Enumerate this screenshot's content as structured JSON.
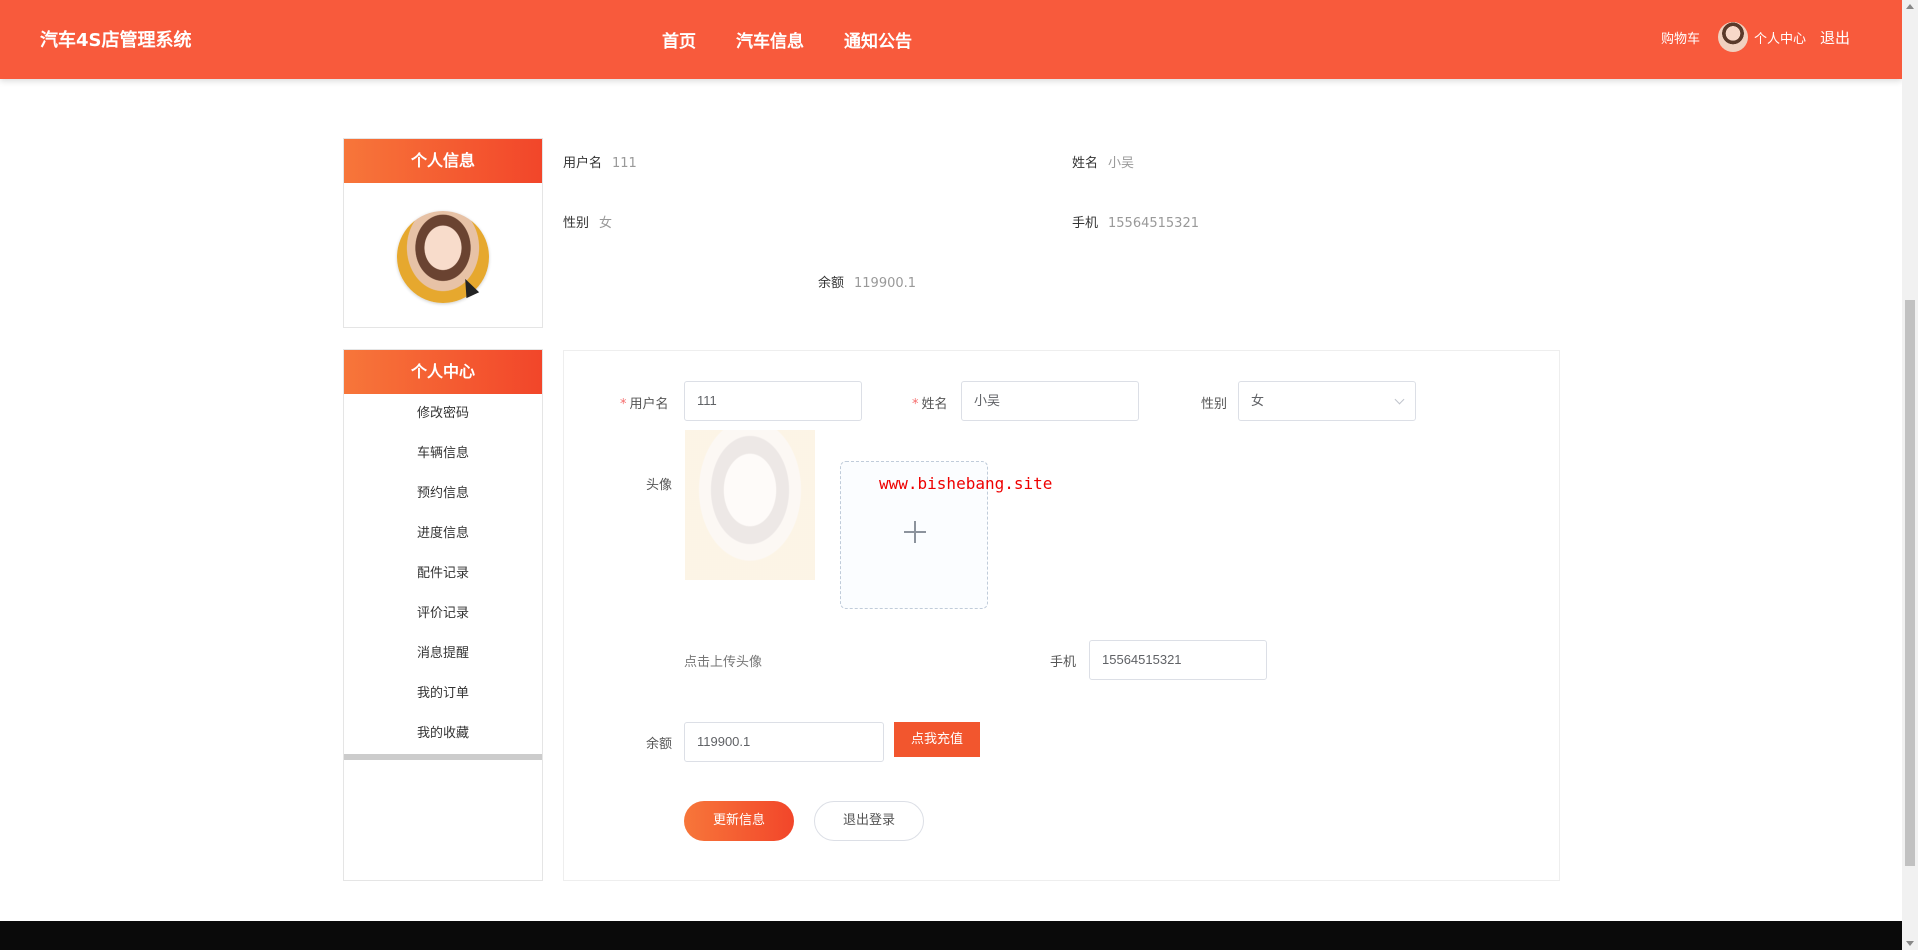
{
  "header": {
    "brand": "汽车4S店管理系统",
    "nav": [
      "首页",
      "汽车信息",
      "通知公告"
    ],
    "cart": "购物车",
    "user_center": "个人中心",
    "logout": "退出"
  },
  "sidebar": {
    "info_title": "个人信息",
    "menu_title": "个人中心",
    "menu_items": [
      "修改密码",
      "车辆信息",
      "预约信息",
      "进度信息",
      "配件记录",
      "评价记录",
      "消息提醒",
      "我的订单",
      "我的收藏"
    ]
  },
  "profile": {
    "username_label": "用户名",
    "username": "111",
    "name_label": "姓名",
    "name": "小吴",
    "gender_label": "性别",
    "gender": "女",
    "phone_label": "手机",
    "phone": "15564515321",
    "balance_label": "余额",
    "balance": "119900.1"
  },
  "form": {
    "username_label": "用户名",
    "username": "111",
    "name_label": "姓名",
    "name": "小吴",
    "gender_label": "性别",
    "gender": "女",
    "avatar_label": "头像",
    "upload_hint": "点击上传头像",
    "watermark": "www.bishebang.site",
    "phone_label": "手机",
    "phone": "15564515321",
    "balance_label": "余额",
    "balance": "119900.1",
    "recharge_button": "点我充值",
    "update_button": "更新信息",
    "logout_button": "退出登录"
  },
  "colors": {
    "primary": "#f85a3c",
    "gradient_start": "#f7763a",
    "gradient_end": "#f2462a"
  }
}
